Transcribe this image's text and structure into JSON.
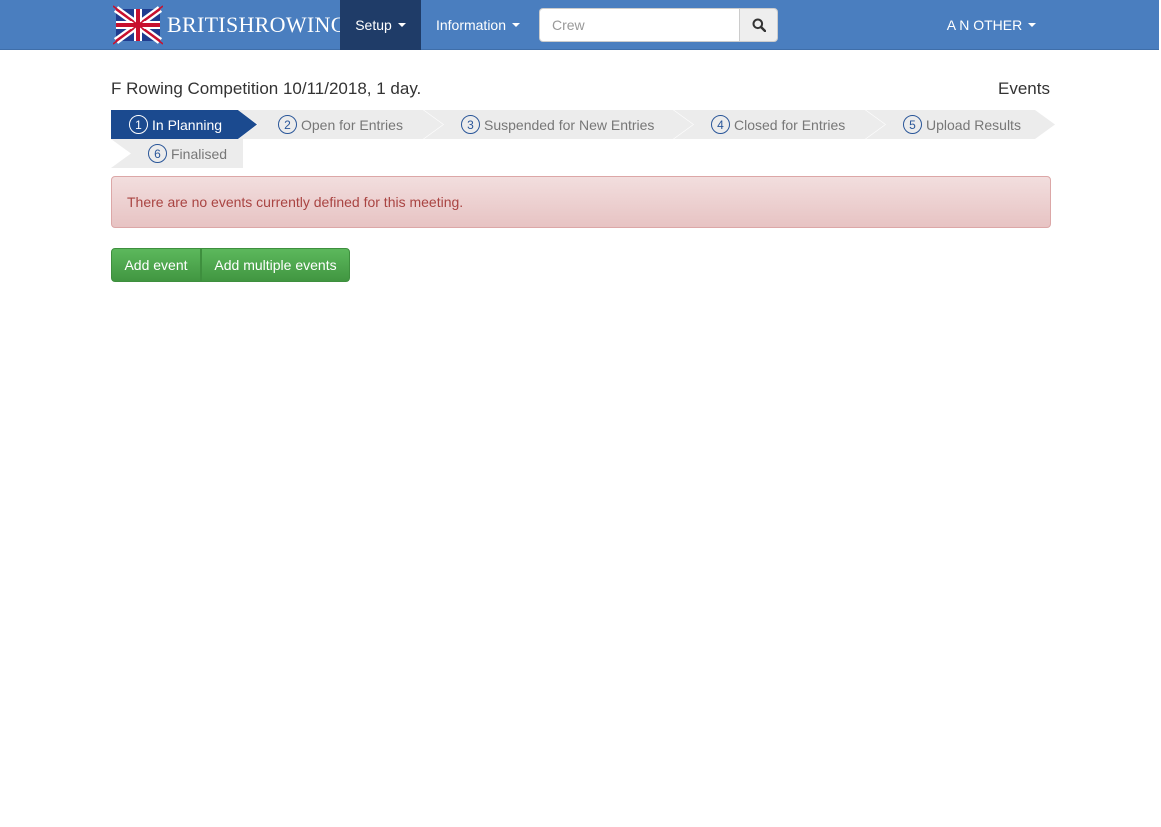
{
  "navbar": {
    "brand": "BRITISHROWING",
    "setup_label": "Setup",
    "information_label": "Information",
    "search_placeholder": "Crew",
    "user_label": "A N OTHER"
  },
  "page": {
    "title": "F Rowing Competition 10/11/2018, 1 day.",
    "section": "Events"
  },
  "steps": [
    {
      "number": "1",
      "label": "In Planning",
      "active": true
    },
    {
      "number": "2",
      "label": "Open for Entries",
      "active": false
    },
    {
      "number": "3",
      "label": "Suspended for New Entries",
      "active": false
    },
    {
      "number": "4",
      "label": "Closed for Entries",
      "active": false
    },
    {
      "number": "5",
      "label": "Upload Results",
      "active": false
    },
    {
      "number": "6",
      "label": "Finalised",
      "active": false
    }
  ],
  "alert": {
    "message": "There are no events currently defined for this meeting."
  },
  "actions": {
    "add_event": "Add event",
    "add_multiple": "Add multiple events"
  },
  "colors": {
    "navbar": "#4a7ebf",
    "active_nav": "#1f3c68",
    "active_step": "#1b4a8f",
    "inactive_step": "#ececec",
    "success": "#5cb85c",
    "alert_text": "#a94442"
  }
}
